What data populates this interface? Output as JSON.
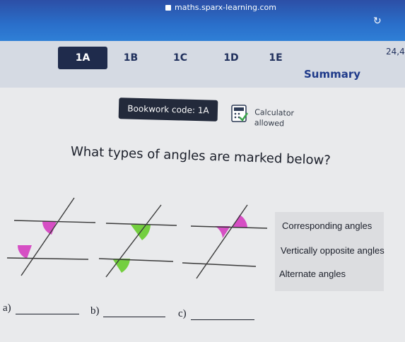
{
  "browser": {
    "url": "maths.sparx-learning.com"
  },
  "tabs": [
    {
      "label": "1A",
      "active": true
    },
    {
      "label": "1B",
      "active": false
    },
    {
      "label": "1C",
      "active": false
    },
    {
      "label": "1D",
      "active": false
    },
    {
      "label": "1E",
      "active": false
    },
    {
      "label": "Summary",
      "active": false
    }
  ],
  "header": {
    "score": "24,4"
  },
  "bookwork": {
    "label": "Bookwork code: 1A"
  },
  "calculator": {
    "line1": "Calculator",
    "line2": "allowed"
  },
  "question": {
    "text": "What types of angles are marked below?"
  },
  "options": [
    "Corresponding angles",
    "Vertically opposite angles",
    "Alternate  angles"
  ],
  "answers": {
    "a_label": "a)",
    "b_label": "b)",
    "c_label": "c)"
  },
  "colors": {
    "brand_blue": "#2a6fca",
    "active_tab": "#1f2b4c",
    "pink": "#d64fc4",
    "green": "#74cf3f"
  }
}
